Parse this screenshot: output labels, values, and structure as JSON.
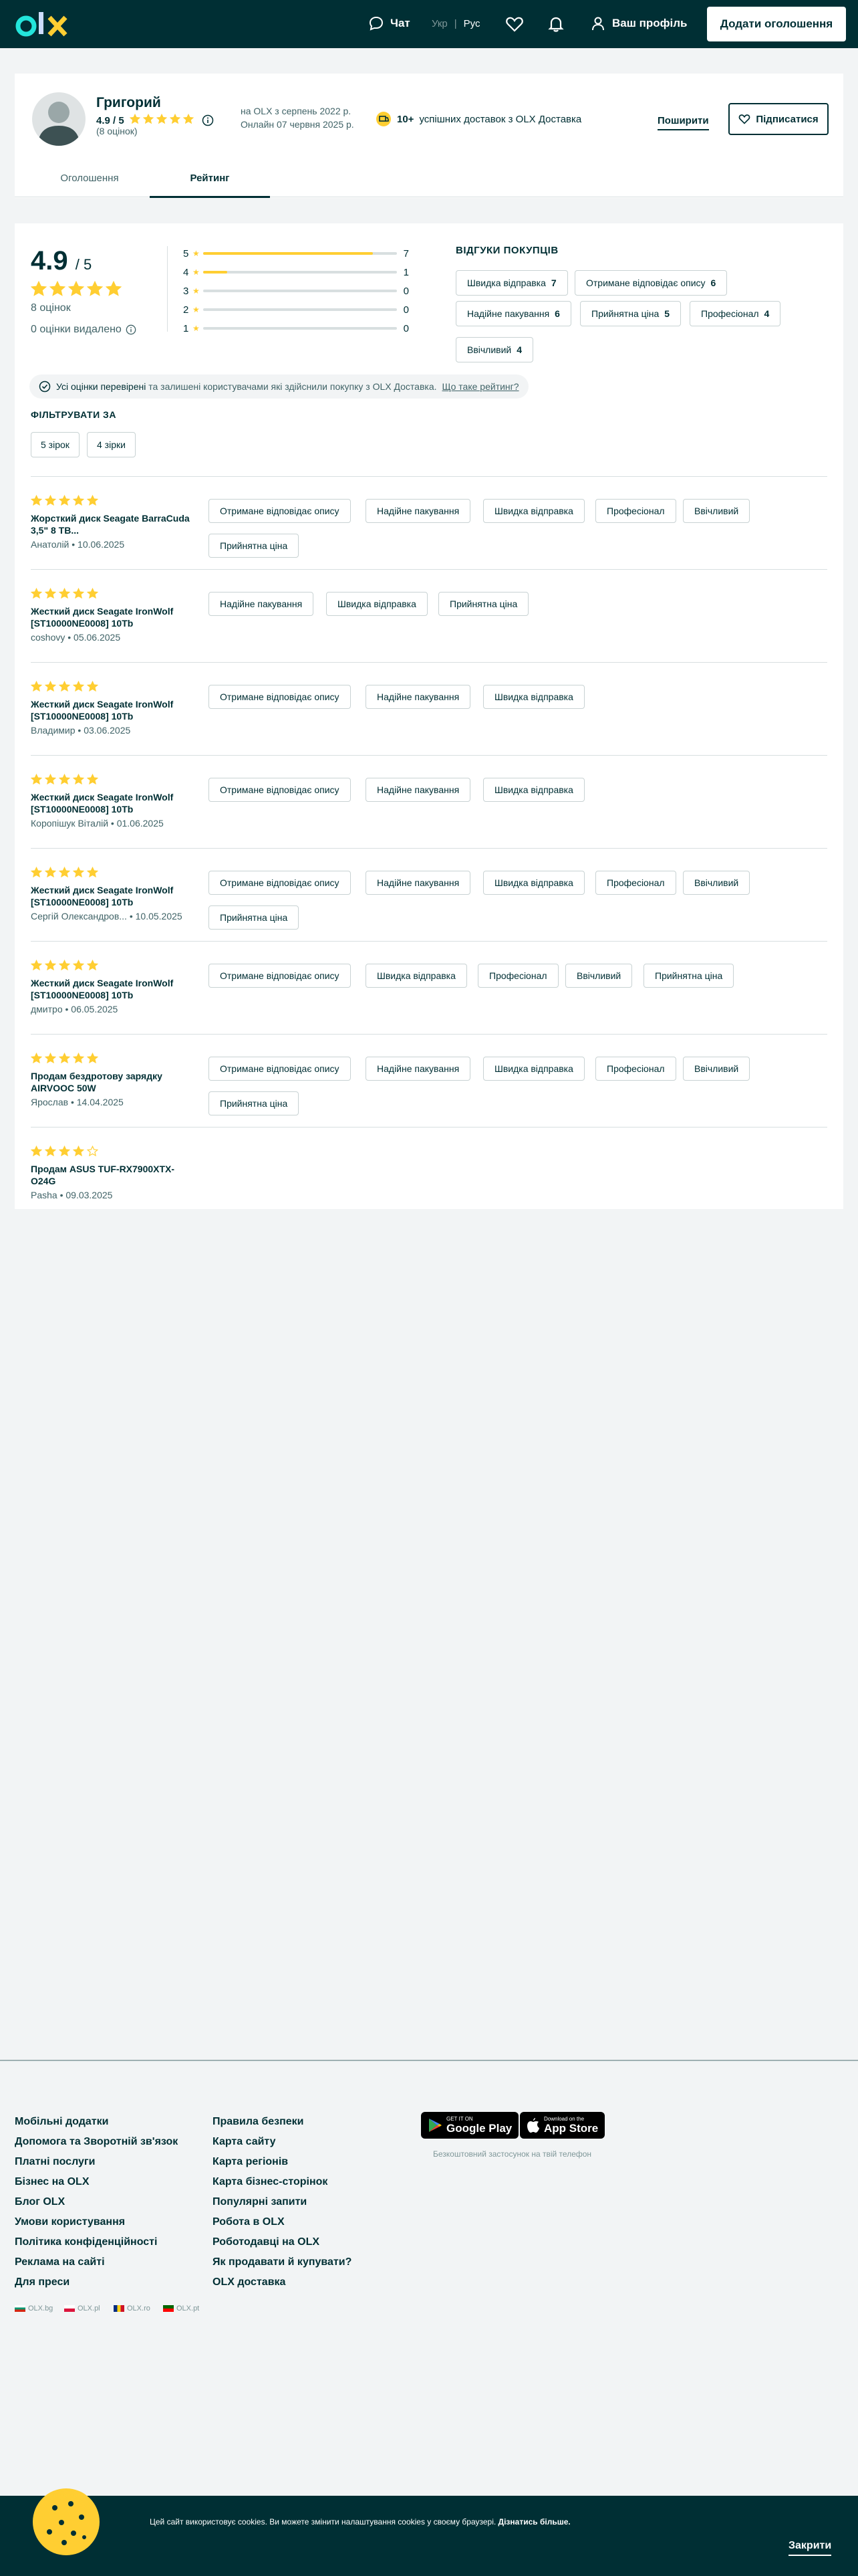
{
  "header": {
    "chat_label": "Чат",
    "lang_uk": "Укр",
    "lang_sep": "|",
    "lang_ru": "Рус",
    "profile_label": "Ваш профіль",
    "add_button": "Додати оголошення"
  },
  "profile": {
    "name": "Григорий",
    "rating": "4.9 / 5",
    "count": "(8 оцінок)",
    "since": "на OLX з серпень 2022 р.",
    "online": "Онлайн 07 червня 2025 р.",
    "deliveries_bold": "10+",
    "deliveries_text": "успішних доставок з OLX Доставка",
    "share": "Поширити",
    "subscribe": "Підписатися",
    "tabs": [
      "Оголошення",
      "Рейтинг"
    ]
  },
  "rating": {
    "value": "4.9",
    "out_of": "/ 5",
    "total": "8 оцінок",
    "removed": "0 оцінки видалено",
    "distribution": [
      {
        "star": "5",
        "count": 7,
        "fraction": 0.875
      },
      {
        "star": "4",
        "count": 1,
        "fraction": 0.125
      },
      {
        "star": "3",
        "count": 0,
        "fraction": 0
      },
      {
        "star": "2",
        "count": 0,
        "fraction": 0
      },
      {
        "star": "1",
        "count": 0,
        "fraction": 0
      }
    ],
    "feedback_title": "ВІДГУКИ ПОКУПЦІВ",
    "feedback": [
      {
        "label": "Швидка відправка",
        "count": "7"
      },
      {
        "label": "Отримане відповідає опису",
        "count": "6"
      },
      {
        "label": "Надійне пакування",
        "count": "6"
      },
      {
        "label": "Прийнятна ціна",
        "count": "5"
      },
      {
        "label": "Професіонал",
        "count": "4"
      },
      {
        "label": "Ввічливий",
        "count": "4"
      }
    ],
    "verified_strong": "Усі оцінки перевірені",
    "verified_rest": " та залишені користувачами які здійснили покупку з OLX Доставка.",
    "verified_link": "Що таке рейтинг?",
    "filter_title": "ФІЛЬТРУВАТИ ЗА",
    "filters": [
      "5 зірок",
      "4 зірки"
    ]
  },
  "reviews": [
    {
      "stars": 5,
      "title": "Жорсткий диск Seagate BarraCuda 3,5\" 8 TB...",
      "author": "Анатолій",
      "date": "10.06.2025",
      "tags": [
        "Отримане відповідає опису",
        "Надійне пакування",
        "Швидка відправка",
        "Професіонал",
        "Ввічливий",
        "Прийнятна ціна"
      ]
    },
    {
      "stars": 5,
      "title": "Жесткий диск Seagate IronWolf [ST10000NE0008] 10Tb",
      "author": "coshovy",
      "date": "05.06.2025",
      "tags": [
        "Надійне пакування",
        "Швидка відправка",
        "Прийнятна ціна"
      ]
    },
    {
      "stars": 5,
      "title": "Жесткий диск Seagate IronWolf [ST10000NE0008] 10Tb",
      "author": "Владимир",
      "date": "03.06.2025",
      "tags": [
        "Отримане відповідає опису",
        "Надійне пакування",
        "Швидка відправка"
      ]
    },
    {
      "stars": 5,
      "title": "Жесткий диск Seagate IronWolf [ST10000NE0008] 10Tb",
      "author": "Коропішук Віталій",
      "date": "01.06.2025",
      "tags": [
        "Отримане відповідає опису",
        "Надійне пакування",
        "Швидка відправка"
      ]
    },
    {
      "stars": 5,
      "title": "Жесткий диск Seagate IronWolf [ST10000NE0008] 10Tb",
      "author": "Сергій Олександров...",
      "date": "10.05.2025",
      "tags": [
        "Отримане відповідає опису",
        "Надійне пакування",
        "Швидка відправка",
        "Професіонал",
        "Ввічливий",
        "Прийнятна ціна"
      ]
    },
    {
      "stars": 5,
      "title": "Жесткий диск Seagate IronWolf [ST10000NE0008] 10Tb",
      "author": "дмитро",
      "date": "06.05.2025",
      "tags": [
        "Отримане відповідає опису",
        "Швидка відправка",
        "Професіонал",
        "Ввічливий",
        "Прийнятна ціна"
      ]
    },
    {
      "stars": 5,
      "title": "Продам бездротову зарядку AIRVOOC 50W",
      "author": "Ярослав",
      "date": "14.04.2025",
      "tags": [
        "Отримане відповідає опису",
        "Надійне пакування",
        "Швидка відправка",
        "Професіонал",
        "Ввічливий",
        "Прийнятна ціна"
      ]
    },
    {
      "stars": 4,
      "title": "Продам ASUS TUF-RX7900XTX-O24G",
      "author": "Pasha",
      "date": "09.03.2025",
      "tags": []
    }
  ],
  "footer": {
    "col1": [
      "Мобільні додатки",
      "Допомога та Зворотній зв'язок",
      "Платні послуги",
      "Бізнес на OLX",
      "Блог OLX",
      "Умови користування",
      "Політика конфіденційності",
      "Реклама на сайті",
      "Для преси"
    ],
    "col2": [
      "Правила безпеки",
      "Карта сайту",
      "Карта регіонів",
      "Карта бізнес-сторінок",
      "Популярні запити",
      "Робота в OLX",
      "Роботодавці на OLX",
      "Як продавати й купувати?",
      "OLX доставка"
    ],
    "google_small": "GET IT ON",
    "google_big": "Google Play",
    "apple_small": "Download on the",
    "apple_big": "App Store",
    "free_app": "Безкоштовний застосунок на твій телефон",
    "countries": [
      "OLX.bg",
      "OLX.pl",
      "OLX.ro",
      "OLX.pt"
    ]
  },
  "cookie": {
    "text": "Цей сайт використовує cookies. Ви можете змінити налаштування cookies у своєму браузері.",
    "more": "Дізнатись більше.",
    "close": "Закрити"
  },
  "colors": {
    "brand": "#002f34",
    "star": "#ffce32",
    "logo_teal": "#23e5db"
  }
}
